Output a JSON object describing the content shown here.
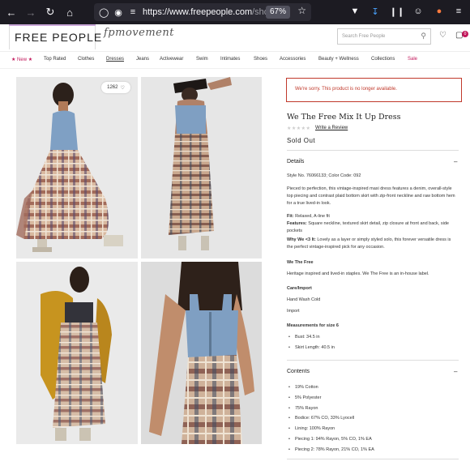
{
  "browser": {
    "url_domain": "https://www.freepeople.com",
    "url_path": "/shop/m",
    "zoom": "67%"
  },
  "site": {
    "logo": "FREE PEOPLE",
    "sub_brand": "fpmovement",
    "search_placeholder": "Search Free People",
    "bag_count": "0"
  },
  "nav": {
    "items": [
      {
        "label": "★ New ★"
      },
      {
        "label": "Top Rated"
      },
      {
        "label": "Clothes"
      },
      {
        "label": "Dresses"
      },
      {
        "label": "Jeans"
      },
      {
        "label": "Activewear"
      },
      {
        "label": "Swim"
      },
      {
        "label": "Intimates"
      },
      {
        "label": "Shoes"
      },
      {
        "label": "Accessories"
      },
      {
        "label": "Beauty + Wellness"
      },
      {
        "label": "Collections"
      },
      {
        "label": "Sale"
      }
    ]
  },
  "gallery": {
    "likes": "1262"
  },
  "product": {
    "alert": "We're sorry. This product is no longer available.",
    "title": "We The Free Mix It Up Dress",
    "stars": "★★★★★",
    "review_link": "Write a Review",
    "status": "Sold Out",
    "details": {
      "heading": "Details",
      "style_line": "Style No. 76066133; Color Code: 092",
      "description": "Pieced to perfection, this vintage-inspired maxi dress features a denim, overall-style top piecing and contrast plaid bottom skirt with zip-front neckline and raw bottom hem for a true lived-in look.",
      "fit_label": "Fit:",
      "fit": "Relaxed, A-line fit",
      "features_label": "Features:",
      "features": "Square neckline, textured skirt detail, zip closure at front and back, side pockets",
      "why_label": "Why We <3 It:",
      "why": "Lovely as a layer or simply styled solo, this forever versatile dress is the perfect vintage-inspired pick for any occasion.",
      "brand_heading": "We The Free",
      "brand_text": "Heritage inspired and lived-in staples. We The Free is an in-house label.",
      "care_heading": "Care/Import",
      "care": "Hand Wash Cold",
      "import": "Import",
      "measure_heading": "Measurements for size 6",
      "measurements": [
        "Bust: 34.5 in",
        "Skirt Length: 40.5 in"
      ]
    },
    "contents": {
      "heading": "Contents",
      "items": [
        "19% Cotton",
        "5% Polyester",
        "75% Rayon",
        "Bodice: 67% CO, 33% Lyocell",
        "Lining: 100% Rayon",
        "Piecing 1: 94% Rayon, 5% CO, 1% EA",
        "Piecing 2: 78% Rayon, 21% CO, 1% EA"
      ]
    }
  }
}
